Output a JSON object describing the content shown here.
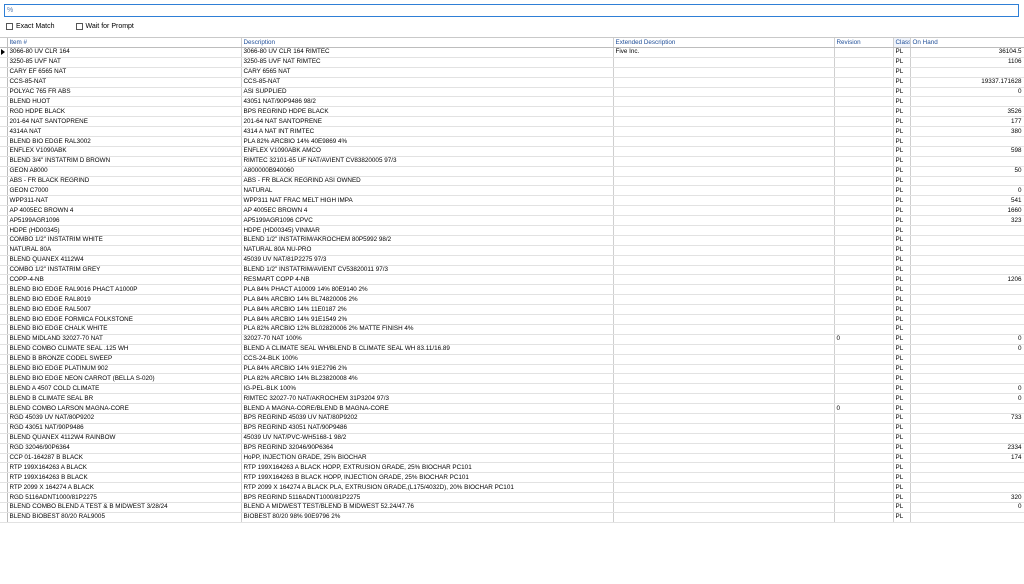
{
  "search": {
    "value": "",
    "placeholder": "%"
  },
  "options": {
    "exact_match": "Exact Match",
    "wait_for_prompt": "Wait for Prompt"
  },
  "columns": {
    "item": "Item #",
    "description": "Description",
    "extended": "Extended Description",
    "revision": "Revision",
    "class": "Class",
    "on_hand": "On Hand"
  },
  "rows": [
    {
      "item": "3066-80 UV CLR 164",
      "desc": "3066-80 UV CLR 164 RIMTEC",
      "ext": "Five Inc.",
      "rev": "",
      "cls": "PL",
      "oh": "36104.5"
    },
    {
      "item": "3250-85 UVF NAT",
      "desc": "3250-85 UVF NAT RIMTEC",
      "ext": "",
      "rev": "",
      "cls": "PL",
      "oh": "1106"
    },
    {
      "item": "CARY EF 6565 NAT",
      "desc": "CARY 6565 NAT",
      "ext": "",
      "rev": "",
      "cls": "PL",
      "oh": ""
    },
    {
      "item": "CCS-85-NAT",
      "desc": "CCS-85-NAT",
      "ext": "",
      "rev": "",
      "cls": "PL",
      "oh": "19337.171628"
    },
    {
      "item": "POLYAC 765 FR ABS",
      "desc": "ASI SUPPLIED",
      "ext": "",
      "rev": "",
      "cls": "PL",
      "oh": "0"
    },
    {
      "item": "BLEND HUOT",
      "desc": "43051 NAT/90P9486 98/2",
      "ext": "",
      "rev": "",
      "cls": "PL",
      "oh": ""
    },
    {
      "item": "RGD HDPE BLACK",
      "desc": "BPS REGRIND HDPE BLACK",
      "ext": "",
      "rev": "",
      "cls": "PL",
      "oh": "3526"
    },
    {
      "item": "201-64 NAT SANTOPRENE",
      "desc": "201-64 NAT SANTOPRENE",
      "ext": "",
      "rev": "",
      "cls": "PL",
      "oh": "177"
    },
    {
      "item": "4314A NAT",
      "desc": "4314 A NAT INT RIMTEC",
      "ext": "",
      "rev": "",
      "cls": "PL",
      "oh": "380"
    },
    {
      "item": "BLEND BIO EDGE RAL3002",
      "desc": "PLA 82% ARCBIO 14% 40E9869 4%",
      "ext": "",
      "rev": "",
      "cls": "PL",
      "oh": ""
    },
    {
      "item": "ENFLEX V1090ABK",
      "desc": "ENFLEX V1090ABK AMCO",
      "ext": "",
      "rev": "",
      "cls": "PL",
      "oh": "598"
    },
    {
      "item": "BLEND 3/4\" INSTATRIM D BROWN",
      "desc": "RIMTEC 32101-65 UF NAT/AVIENT CV83820005 97/3",
      "ext": "",
      "rev": "",
      "cls": "PL",
      "oh": ""
    },
    {
      "item": "GEON A8000",
      "desc": "A800000B940060",
      "ext": "",
      "rev": "",
      "cls": "PL",
      "oh": "50"
    },
    {
      "item": "ABS - FR BLACK REGRIND",
      "desc": "ABS - FR BLACK REGRIND ASI OWNED",
      "ext": "",
      "rev": "",
      "cls": "PL",
      "oh": ""
    },
    {
      "item": "GEON C7000",
      "desc": "NATURAL",
      "ext": "",
      "rev": "",
      "cls": "PL",
      "oh": "0"
    },
    {
      "item": "WPP311-NAT",
      "desc": "WPP311 NAT FRAC MELT HIGH IMPA",
      "ext": "",
      "rev": "",
      "cls": "PL",
      "oh": "541"
    },
    {
      "item": "AP 4005EC BROWN 4",
      "desc": "AP 4005EC BROWN 4",
      "ext": "",
      "rev": "",
      "cls": "PL",
      "oh": "1660"
    },
    {
      "item": "AP5199AGR1096",
      "desc": "AP5199AGR1096 CPVC",
      "ext": "",
      "rev": "",
      "cls": "PL",
      "oh": "323"
    },
    {
      "item": "HDPE (HD00345)",
      "desc": "HDPE (HD00345) VINMAR",
      "ext": "",
      "rev": "",
      "cls": "PL",
      "oh": ""
    },
    {
      "item": "COMBO 1/2\" INSTATRIM WHITE",
      "desc": "BLEND 1/2\" INSTATRIM/AKROCHEM 80P5992 98/2",
      "ext": "",
      "rev": "",
      "cls": "PL",
      "oh": ""
    },
    {
      "item": "NATURAL 80A",
      "desc": "NATURAL 80A NU-PRO",
      "ext": "",
      "rev": "",
      "cls": "PL",
      "oh": ""
    },
    {
      "item": "BLEND QUANEX 4112W4",
      "desc": "45039 UV NAT/81P2275 97/3",
      "ext": "",
      "rev": "",
      "cls": "PL",
      "oh": ""
    },
    {
      "item": "COMBO 1/2\" INSTATRIM GREY",
      "desc": "BLEND 1/2\" INSTATRIM/AVIENT CV53820011 97/3",
      "ext": "",
      "rev": "",
      "cls": "PL",
      "oh": ""
    },
    {
      "item": "COPP-4-NB",
      "desc": "RESMART COPP 4-NB",
      "ext": "",
      "rev": "",
      "cls": "PL",
      "oh": "1206"
    },
    {
      "item": "BLEND BIO EDGE RAL9016 PHACT A1000P",
      "desc": "PLA 84% PHACT A10009 14% 80E9140 2%",
      "ext": "",
      "rev": "",
      "cls": "PL",
      "oh": ""
    },
    {
      "item": "BLEND BIO EDGE RAL8019",
      "desc": "PLA 84% ARCBIO 14% BL74820006 2%",
      "ext": "",
      "rev": "",
      "cls": "PL",
      "oh": ""
    },
    {
      "item": "BLEND BIO EDGE RAL5007",
      "desc": "PLA 84% ARCBIO 14% 11E0187 2%",
      "ext": "",
      "rev": "",
      "cls": "PL",
      "oh": ""
    },
    {
      "item": "BLEND BIO EDGE FORMICA FOLKSTONE",
      "desc": "PLA 84% ARCBIO 14% 91E1549 2%",
      "ext": "",
      "rev": "",
      "cls": "PL",
      "oh": ""
    },
    {
      "item": "BLEND BIO EDGE CHALK WHITE",
      "desc": "PLA 82% ARCBIO 12% BL02820006 2% MATTE FINISH 4%",
      "ext": "",
      "rev": "",
      "cls": "PL",
      "oh": ""
    },
    {
      "item": "BLEND MIDLAND 32027-70 NAT",
      "desc": "32027-70 NAT 100%",
      "ext": "",
      "rev": "0",
      "cls": "PL",
      "oh": "0"
    },
    {
      "item": "BLEND COMBO CLIMATE SEAL .125 WH",
      "desc": "BLEND A CLIMATE SEAL WH/BLEND B CLIMATE SEAL WH 83.11/16.89",
      "ext": "",
      "rev": "",
      "cls": "PL",
      "oh": "0"
    },
    {
      "item": "BLEND B BRONZE CODEL SWEEP",
      "desc": "CCS-24-BLK 100%",
      "ext": "",
      "rev": "",
      "cls": "PL",
      "oh": ""
    },
    {
      "item": "BLEND BIO EDGE PLATINUM 902",
      "desc": "PLA 84% ARCBIO 14% 91E2796 2%",
      "ext": "",
      "rev": "",
      "cls": "PL",
      "oh": ""
    },
    {
      "item": "BLEND BIO EDGE NEON CARROT (BELLA S-020)",
      "desc": "PLA 82% ARCBIO 14% BL23820008 4%",
      "ext": "",
      "rev": "",
      "cls": "PL",
      "oh": ""
    },
    {
      "item": "BLEND A 4507 COLD CLIMATE",
      "desc": "IG-PEL-BLK 100%",
      "ext": "",
      "rev": "",
      "cls": "PL",
      "oh": "0"
    },
    {
      "item": "BLEND B CLIMATE SEAL BR",
      "desc": "RIMTEC 32027-70 NAT/AKROCHEM 31P3204 97/3",
      "ext": "",
      "rev": "",
      "cls": "PL",
      "oh": "0"
    },
    {
      "item": "BLEND COMBO LARSON MAGNA-CORE",
      "desc": "BLEND A MAGNA-CORE/BLEND B MAGNA-CORE",
      "ext": "",
      "rev": "0",
      "cls": "PL",
      "oh": ""
    },
    {
      "item": "RGD 45039 UV NAT/80P9202",
      "desc": "BPS REGRIND 45039 UV NAT/80P9202",
      "ext": "",
      "rev": "",
      "cls": "PL",
      "oh": "733"
    },
    {
      "item": "RGD 43051 NAT/90P9486",
      "desc": "BPS REGRIND 43051 NAT/90P9486",
      "ext": "",
      "rev": "",
      "cls": "PL",
      "oh": ""
    },
    {
      "item": "BLEND QUANEX 4112W4 RAINBOW",
      "desc": "45039 UV NAT/PVC-WH5168-1 98/2",
      "ext": "",
      "rev": "",
      "cls": "PL",
      "oh": ""
    },
    {
      "item": "RGD 32046/90P6364",
      "desc": "BPS REGRIND 32046/90P6364",
      "ext": "",
      "rev": "",
      "cls": "PL",
      "oh": "2334"
    },
    {
      "item": "CCP 01-164287 B BLACK",
      "desc": "HoPP, INJECTION GRADE, 25% BIOCHAR",
      "ext": "",
      "rev": "",
      "cls": "PL",
      "oh": "174"
    },
    {
      "item": "RTP 199X164263 A BLACK",
      "desc": "RTP 199X164263 A BLACK HOPP, EXTRUSION GRADE, 25% BIOCHAR PC101",
      "ext": "",
      "rev": "",
      "cls": "PL",
      "oh": ""
    },
    {
      "item": "RTP 199X164263 B BLACK",
      "desc": "RTP 199X164263 B BLACK HOPP, INJECTION GRADE, 25% BIOCHAR PC101",
      "ext": "",
      "rev": "",
      "cls": "PL",
      "oh": ""
    },
    {
      "item": "RTP 2099 X 164274 A BLACK",
      "desc": "RTP 2099 X 164274 A BLACK PLA, EXTRUSION GRADE,(L175/4032D), 20% BIOCHAR PC101",
      "ext": "",
      "rev": "",
      "cls": "PL",
      "oh": ""
    },
    {
      "item": "RGD 5116ADNT1000/81P2275",
      "desc": "BPS REGRIND 5116ADNT1000/81P2275",
      "ext": "",
      "rev": "",
      "cls": "PL",
      "oh": "320"
    },
    {
      "item": "BLEND COMBO BLEND A TEST & B MIDWEST 3/28/24",
      "desc": "BLEND A MIDWEST TEST/BLEND B MIDWEST 52.24/47.76",
      "ext": "",
      "rev": "",
      "cls": "PL",
      "oh": "0"
    },
    {
      "item": "BLEND BIOBEST 80/20 RAL9005",
      "desc": "BIOBEST 80/20 98% 90E9796 2%",
      "ext": "",
      "rev": "",
      "cls": "PL",
      "oh": ""
    }
  ]
}
